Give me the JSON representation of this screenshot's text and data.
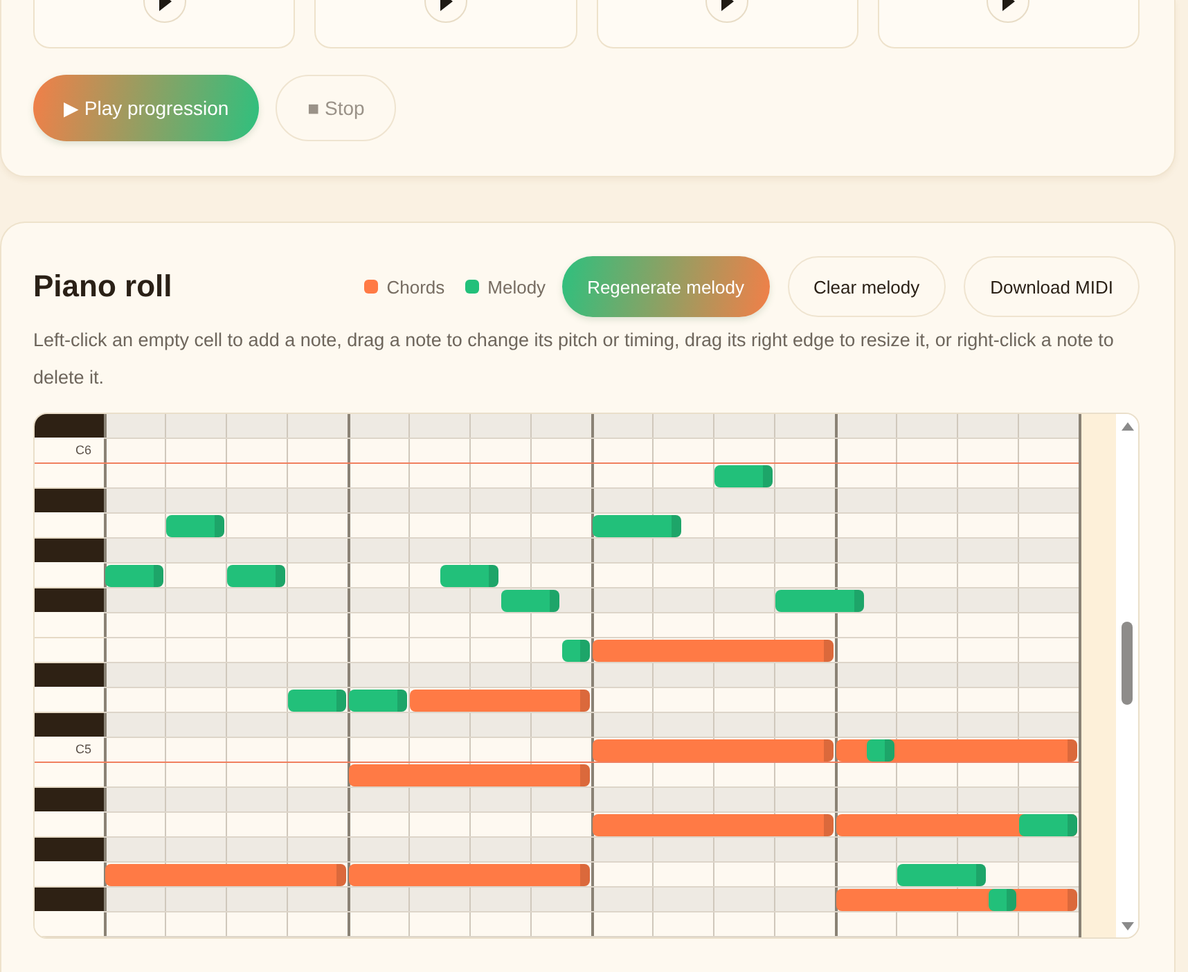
{
  "progression": {
    "cards": [
      {
        "playing": false
      },
      {
        "playing": false
      },
      {
        "playing": false
      },
      {
        "playing": false
      }
    ],
    "buttons": [
      {
        "label": "▶ Play progression",
        "kind": "primary",
        "disabled": false
      },
      {
        "label": "■ Stop",
        "kind": "secondary",
        "disabled": true
      }
    ]
  },
  "piano_roll": {
    "title": "Piano roll",
    "legend": [
      {
        "label": "Chords",
        "color": "#ff7a45"
      },
      {
        "label": "Melody",
        "color": "#22c07a"
      }
    ],
    "buttons": [
      {
        "label": "Regenerate melody",
        "kind": "primary"
      },
      {
        "label": "Clear melody",
        "kind": "secondary"
      },
      {
        "label": "Download MIDI",
        "kind": "secondary"
      }
    ],
    "hint": "Left-click an empty cell to add a note, drag a note to change its pitch or timing, drag its right edge to resize it, or right-click a note to delete it.",
    "keys": [
      {
        "kind": "black"
      },
      {
        "kind": "white",
        "label": "C6"
      },
      {
        "kind": "white"
      },
      {
        "kind": "black"
      },
      {
        "kind": "white"
      },
      {
        "kind": "black"
      },
      {
        "kind": "white"
      },
      {
        "kind": "black"
      },
      {
        "kind": "white"
      },
      {
        "kind": "white"
      },
      {
        "kind": "black"
      },
      {
        "kind": "white"
      },
      {
        "kind": "black"
      },
      {
        "kind": "white",
        "label": "C5"
      },
      {
        "kind": "white"
      },
      {
        "kind": "black"
      },
      {
        "kind": "white"
      },
      {
        "kind": "black"
      },
      {
        "kind": "white"
      },
      {
        "kind": "black"
      },
      {
        "kind": "white"
      }
    ]
  }
}
